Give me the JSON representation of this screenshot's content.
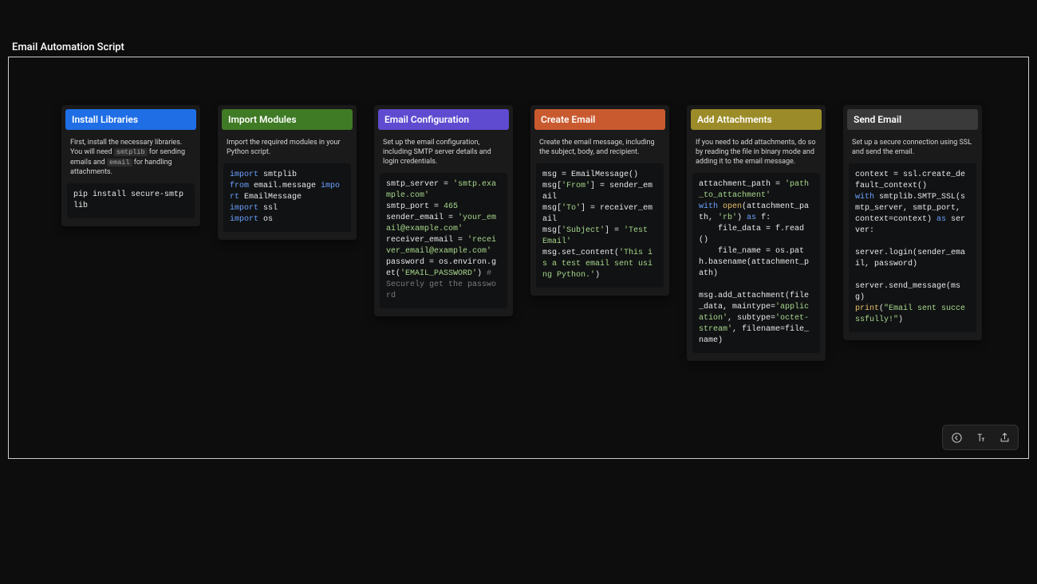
{
  "title": "Email Automation Script",
  "cards": [
    {
      "header": "Install Libraries",
      "desc_parts": [
        "First, install the necessary libraries. You will need ",
        "smtplib",
        " for sending emails and ",
        "email",
        " for handling attachments."
      ],
      "code_html": "pip install secure-smtplib"
    },
    {
      "header": "Import Modules",
      "desc": "Import the required modules in your Python script.",
      "code_html": "<span class='tok-kw'>import</span> smtplib\n<span class='tok-kw'>from</span> email.message <span class='tok-kw'>import</span> EmailMessage\n<span class='tok-kw'>import</span> ssl\n<span class='tok-kw'>import</span> os"
    },
    {
      "header": "Email Configuration",
      "desc": "Set up the email configuration, including SMTP server details and login credentials.",
      "code_html": "smtp_server = <span class='tok-str'>'smtp.example.com'</span>\nsmtp_port = <span class='tok-str'>465</span>\nsender_email = <span class='tok-str'>'your_email@example.com'</span>\nreceiver_email = <span class='tok-str'>'receiver_email@example.com'</span>\npassword = os.environ.get(<span class='tok-str'>'EMAIL_PASSWORD'</span>) <span class='tok-cmt'># Securely get the password</span>"
    },
    {
      "header": "Create Email",
      "desc": "Create the email message, including the subject, body, and recipient.",
      "code_html": "msg = EmailMessage()\nmsg[<span class='tok-str'>'From'</span>] = sender_email\nmsg[<span class='tok-str'>'To'</span>] = receiver_email\nmsg[<span class='tok-str'>'Subject'</span>] = <span class='tok-str'>'Test Email'</span>\nmsg.set_content(<span class='tok-str'>'This is a test email sent using Python.'</span>)"
    },
    {
      "header": "Add Attachments",
      "desc": "If you need to add attachments, do so by reading the file in binary mode and adding it to the email message.",
      "code_html": "attachment_path = <span class='tok-str'>'path_to_attachment'</span>\n<span class='tok-kw'>with</span> <span class='tok-fn'>open</span>(attachment_path, <span class='tok-str'>'rb'</span>) <span class='tok-kw'>as</span> f:\n    file_data = f.read()\n    file_name = os.path.basename(attachment_path)\n\nmsg.add_attachment(file_data, maintype=<span class='tok-str'>'application'</span>, subtype=<span class='tok-str'>'octet-stream'</span>, filename=file_name)"
    },
    {
      "header": "Send Email",
      "desc": "Set up a secure connection using SSL and send the email.",
      "code_html": "context = ssl.create_default_context()\n<span class='tok-kw'>with</span> smtplib.SMTP_SSL(smtp_server, smtp_port, context=context) <span class='tok-kw'>as</span> server:\n\nserver.login(sender_email, password)\n\nserver.send_message(msg)\n<span class='tok-fn'>print</span>(<span class='tok-str'>\"Email sent successfully!\"</span>)"
    }
  ],
  "header_classes": [
    "hdr-blue",
    "hdr-green",
    "hdr-purple",
    "hdr-orange",
    "hdr-olive",
    "hdr-gray"
  ],
  "toolbar": {
    "back": "back",
    "format": "format",
    "share": "share"
  }
}
